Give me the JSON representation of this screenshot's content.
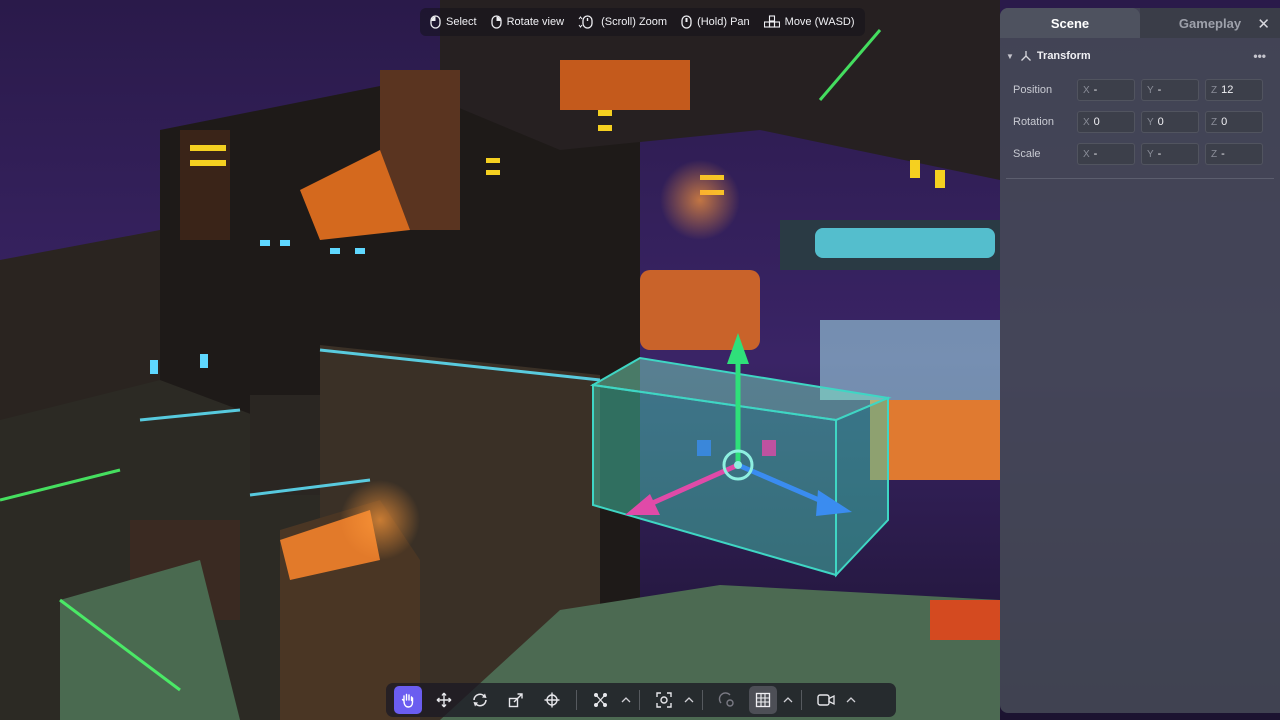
{
  "hints": [
    {
      "icon": "mouse-left-icon",
      "label": "Select"
    },
    {
      "icon": "mouse-right-icon",
      "label": "Rotate view"
    },
    {
      "icon": "scroll-icon",
      "label": "(Scroll) Zoom"
    },
    {
      "icon": "mouse-middle-icon",
      "label": "(Hold) Pan"
    },
    {
      "icon": "wasd-icon",
      "label": "Move (WASD)"
    }
  ],
  "panel": {
    "tabs": [
      {
        "label": "Scene"
      },
      {
        "label": "Gameplay"
      }
    ],
    "close_icon": "close-icon",
    "section_title": "Transform",
    "rows": [
      {
        "label": "Position",
        "x": "-",
        "y": "-",
        "z": "12"
      },
      {
        "label": "Rotation",
        "x": "0",
        "y": "0",
        "z": "0"
      },
      {
        "label": "Scale",
        "x": "-",
        "y": "-",
        "z": "-"
      }
    ],
    "axis_labels": {
      "x": "X",
      "y": "Y",
      "z": "Z"
    }
  },
  "toolbar": {
    "tools": [
      "hand-pan-icon",
      "move-arrows-icon",
      "rotate-icon",
      "scale-icon",
      "transform-all-icon",
      "snap-points-icon",
      "focus-icon",
      "pivot-icon",
      "grid-icon",
      "camera-icon"
    ]
  },
  "colors": {
    "accent": "#6b5df0",
    "gizmo_x": "#e04aa8",
    "gizmo_y": "#2fe07a",
    "gizmo_z": "#3a8cf0",
    "selection": "#3fd6c4"
  }
}
